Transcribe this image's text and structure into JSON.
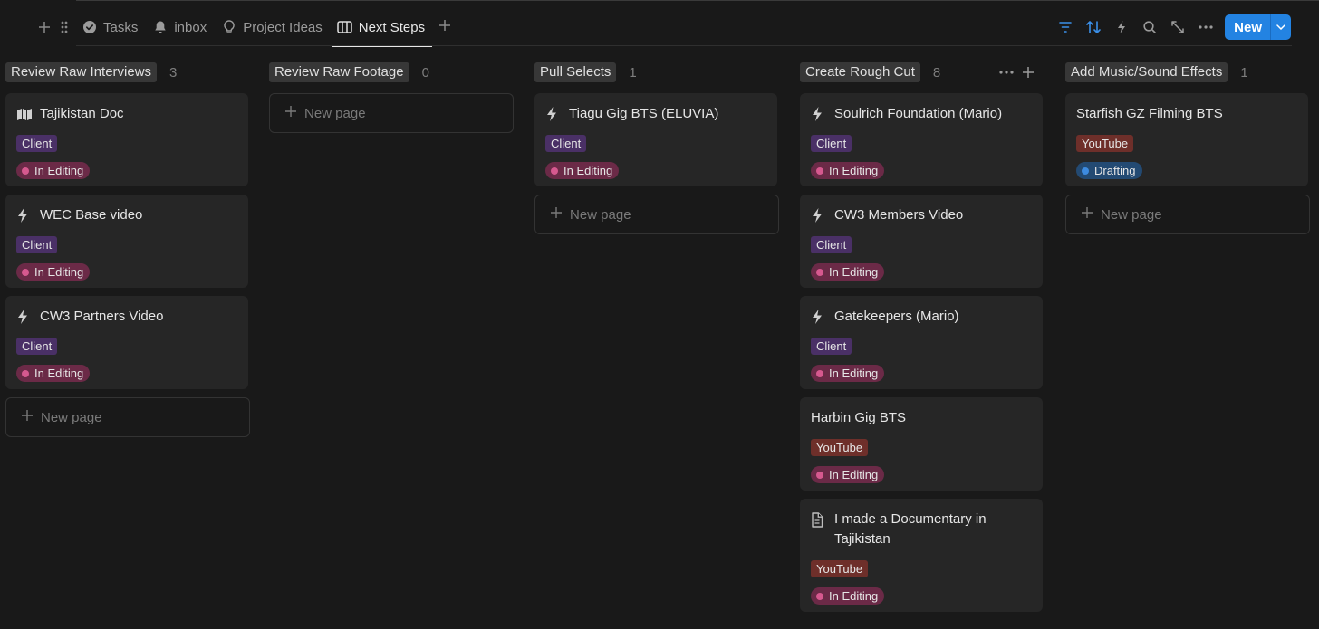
{
  "tabs": [
    {
      "label": "Tasks",
      "icon": "check-circle-icon",
      "active": false
    },
    {
      "label": "inbox",
      "icon": "bell-icon",
      "active": false
    },
    {
      "label": "Project Ideas",
      "icon": "lightbulb-icon",
      "active": false
    },
    {
      "label": "Next Steps",
      "icon": "board-icon",
      "active": true
    }
  ],
  "toolbar": {
    "new_label": "New"
  },
  "new_page_label": "New page",
  "columns": [
    {
      "title": "Review Raw Interviews",
      "count": "3",
      "cards": [
        {
          "title": "Tajikistan Doc",
          "icon": "map-icon",
          "tag": "Client",
          "status": "In Editing"
        },
        {
          "title": "WEC Base video",
          "icon": "bolt-icon",
          "tag": "Client",
          "status": "In Editing"
        },
        {
          "title": "CW3 Partners Video",
          "icon": "bolt-icon",
          "tag": "Client",
          "status": "In Editing"
        }
      ]
    },
    {
      "title": "Review Raw Footage",
      "count": "0",
      "cards": []
    },
    {
      "title": "Pull Selects",
      "count": "1",
      "cards": [
        {
          "title": "Tiagu Gig BTS (ELUVIA)",
          "icon": "bolt-icon",
          "tag": "Client",
          "status": "In Editing"
        }
      ]
    },
    {
      "title": "Create Rough Cut",
      "count": "8",
      "cards": [
        {
          "title": "Soulrich Foundation (Mario)",
          "icon": "bolt-icon",
          "tag": "Client",
          "status": "In Editing"
        },
        {
          "title": "CW3 Members Video",
          "icon": "bolt-icon",
          "tag": "Client",
          "status": "In Editing"
        },
        {
          "title": "Gatekeepers (Mario)",
          "icon": "bolt-icon",
          "tag": "Client",
          "status": "In Editing"
        },
        {
          "title": "Harbin Gig BTS",
          "icon": "",
          "tag": "YouTube",
          "status": "In Editing"
        },
        {
          "title": "I made a Documentary in Tajikistan",
          "icon": "document-icon",
          "tag": "YouTube",
          "status": "In Editing"
        }
      ]
    },
    {
      "title": "Add Music/Sound Effects",
      "count": "1",
      "cards": [
        {
          "title": "Starfish GZ Filming BTS",
          "icon": "",
          "tag": "YouTube",
          "status": "Drafting"
        }
      ]
    }
  ]
}
